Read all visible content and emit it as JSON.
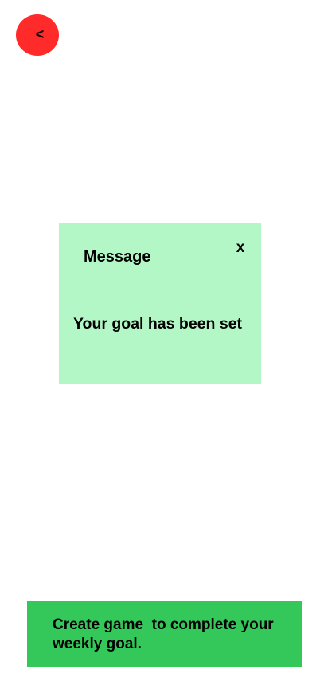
{
  "back_button": {
    "label": "<",
    "color": "#ff2a2a"
  },
  "message_dialog": {
    "title": "Message",
    "close_label": "x",
    "body": "Your goal has been set",
    "background": "#b3f7c6"
  },
  "create_game_banner": {
    "label": "Create game  to complete your weekly goal.",
    "background": "#34c759"
  }
}
